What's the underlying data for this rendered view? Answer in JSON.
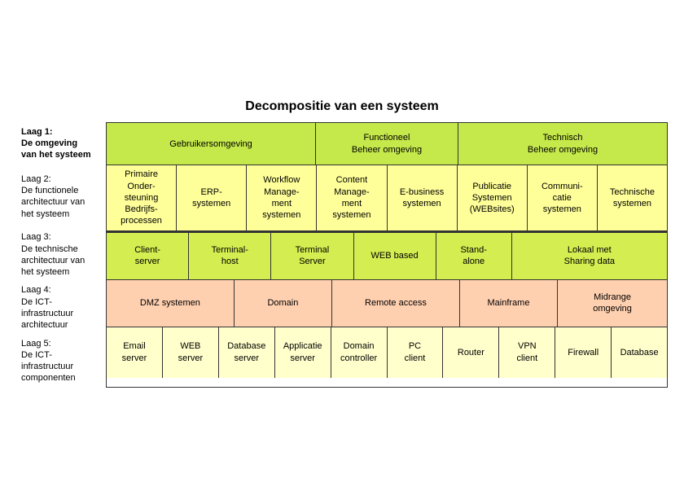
{
  "title": "Decompositie van een systeem",
  "layers": [
    {
      "id": "laag1",
      "label": "Laag 1:\nDe omgeving\nvan het systeem"
    },
    {
      "id": "laag2",
      "label": "Laag 2:\nDe functionele\narchitectuur van\nhet systeem"
    },
    {
      "id": "laag3",
      "label": "Laag 3:\nDe technische\narchitectuur van\nhet systeem"
    },
    {
      "id": "laag4",
      "label": "Laag 4:\nDe ICT-\ninfrastructuur\narchitectuur"
    },
    {
      "id": "laag5",
      "label": "Laag 5:\nDe ICT-\ninfrastructuur\ncomponenten"
    }
  ],
  "rows": [
    {
      "id": "row1",
      "cells": [
        {
          "text": "Gebruikersomgeving",
          "colspan": 3,
          "color": "green-light"
        },
        {
          "text": "Functioneel\nBeheer omgeving",
          "colspan": 2,
          "color": "green-light"
        },
        {
          "text": "Technisch\nBeheer omgeving",
          "colspan": 3,
          "color": "green-light"
        }
      ]
    },
    {
      "id": "row2",
      "cells": [
        {
          "text": "Primaire\nOnder-\nsteuning\nBedrijfs-\nprocessen",
          "colspan": 1,
          "color": "yellow"
        },
        {
          "text": "ERP-\nsystemen",
          "colspan": 1,
          "color": "yellow"
        },
        {
          "text": "Workflow\nManage-\nment\nsystemen",
          "colspan": 1,
          "color": "yellow"
        },
        {
          "text": "Content\nManage-\nment\nsystemen",
          "colspan": 1,
          "color": "yellow"
        },
        {
          "text": "E-business\nsystemen",
          "colspan": 1,
          "color": "yellow"
        },
        {
          "text": "Publicatie\nSystemen\n(WEBsites)",
          "colspan": 1,
          "color": "yellow"
        },
        {
          "text": "Communi-\ncatie\nsystemen",
          "colspan": 1,
          "color": "yellow"
        },
        {
          "text": "Technische\nsystemen",
          "colspan": 1,
          "color": "yellow"
        }
      ]
    },
    {
      "id": "row3",
      "cells": [
        {
          "text": "Client-\nserver",
          "colspan": 1,
          "color": "green-mid"
        },
        {
          "text": "Terminal-\nhost",
          "colspan": 1,
          "color": "green-mid"
        },
        {
          "text": "Terminal\nServer",
          "colspan": 1,
          "color": "green-mid"
        },
        {
          "text": "WEB based",
          "colspan": 1,
          "color": "green-mid"
        },
        {
          "text": "Stand-\nalone",
          "colspan": 1,
          "color": "green-mid"
        },
        {
          "text": "Lokaal met\nSharing data",
          "colspan": 2,
          "color": "green-mid"
        }
      ]
    },
    {
      "id": "row4",
      "cells": [
        {
          "text": "DMZ systemen",
          "colspan": 2,
          "color": "pink"
        },
        {
          "text": "Domain",
          "colspan": 1,
          "color": "pink"
        },
        {
          "text": "Remote access",
          "colspan": 1,
          "color": "pink"
        },
        {
          "text": "Mainframe",
          "colspan": 1,
          "color": "pink"
        },
        {
          "text": "Midrange\nomgeving",
          "colspan": 2,
          "color": "pink"
        }
      ]
    },
    {
      "id": "row5",
      "cells": [
        {
          "text": "Email\nserver",
          "colspan": 1,
          "color": "yellow-light"
        },
        {
          "text": "WEB\nserver",
          "colspan": 1,
          "color": "yellow-light"
        },
        {
          "text": "Database\nserver",
          "colspan": 1,
          "color": "yellow-light"
        },
        {
          "text": "Applicatie\nserver",
          "colspan": 1,
          "color": "yellow-light"
        },
        {
          "text": "Domain\ncontroller",
          "colspan": 1,
          "color": "yellow-light"
        },
        {
          "text": "PC\nclient",
          "colspan": 1,
          "color": "yellow-light"
        },
        {
          "text": "Router",
          "colspan": 1,
          "color": "yellow-light"
        },
        {
          "text": "VPN\nclient",
          "colspan": 1,
          "color": "yellow-light"
        },
        {
          "text": "Firewall",
          "colspan": 1,
          "color": "yellow-light"
        },
        {
          "text": "Database",
          "colspan": 1,
          "color": "yellow-light"
        }
      ]
    }
  ]
}
